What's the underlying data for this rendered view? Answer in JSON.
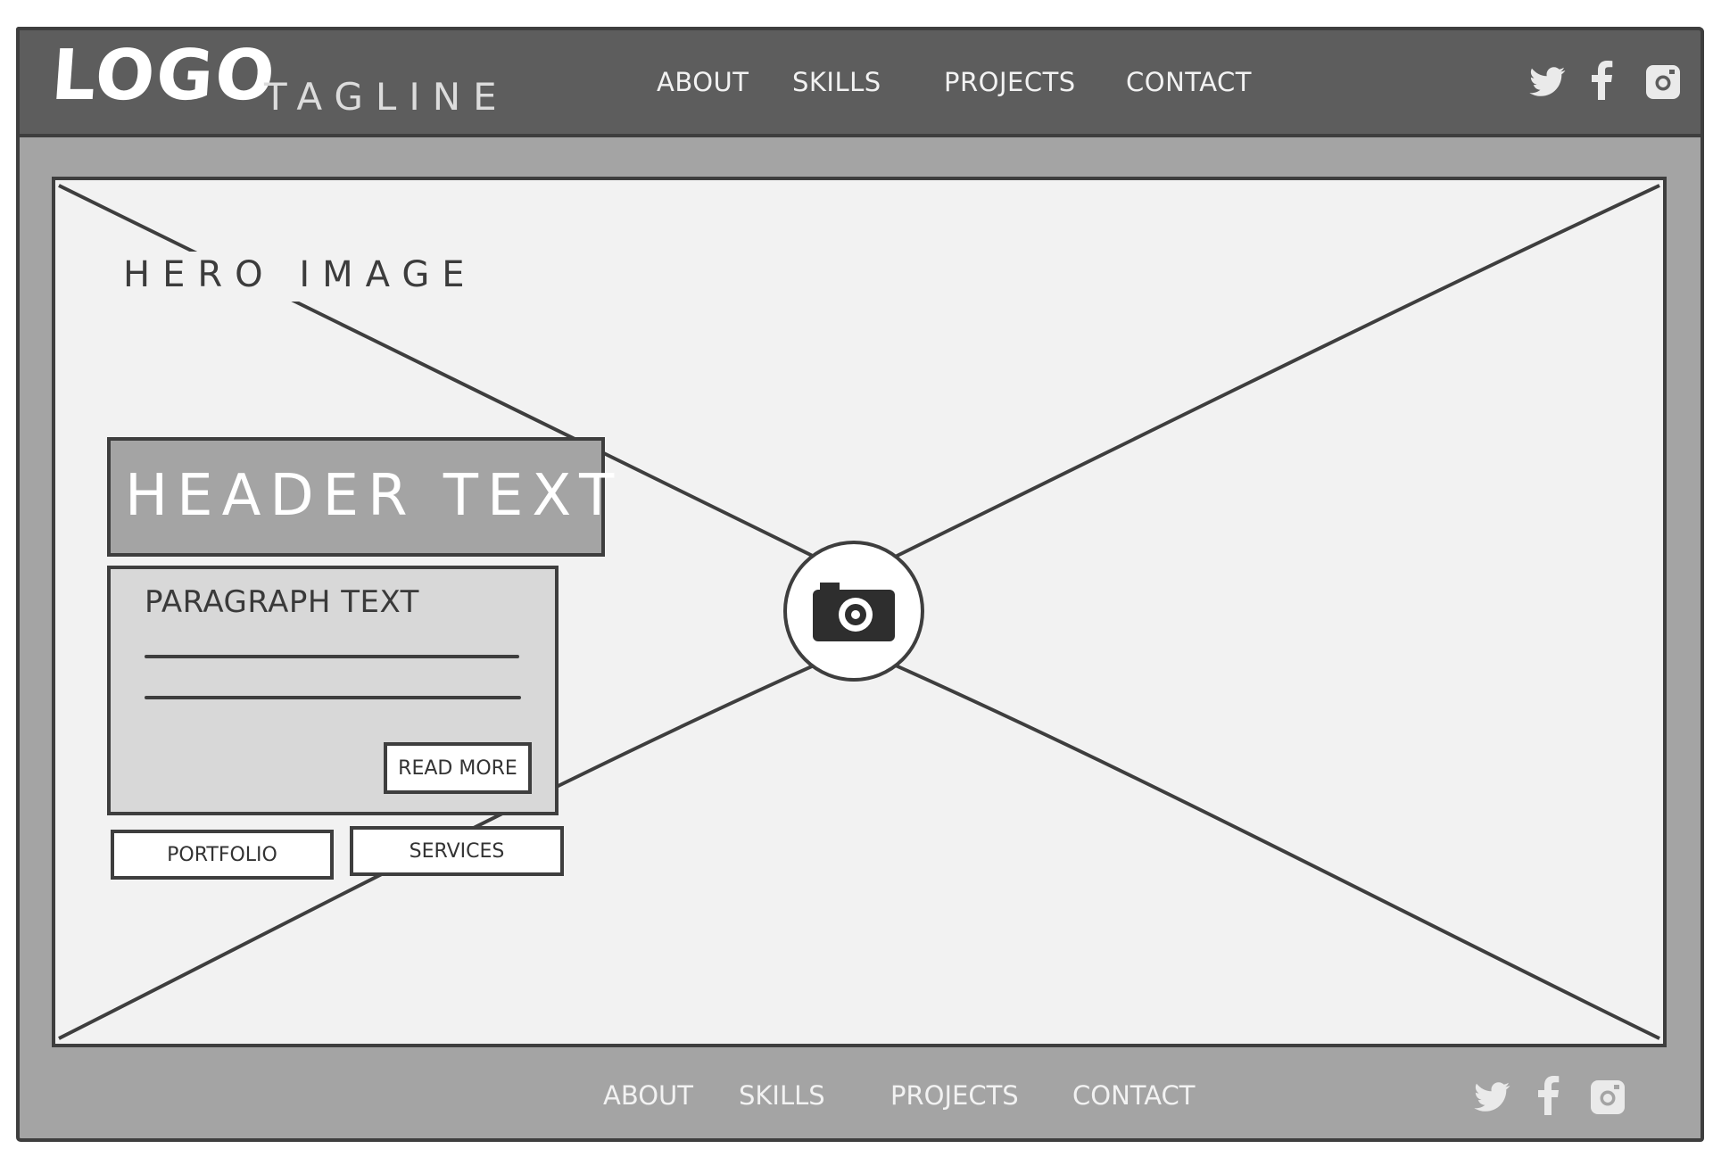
{
  "header": {
    "logo": "LOGO",
    "tagline": "TAGLINE",
    "nav": [
      "ABOUT",
      "SKILLS",
      "PROJECTS",
      "CONTACT"
    ]
  },
  "hero": {
    "label": "HERO IMAGE",
    "header_text": "HEADER TEXT",
    "paragraph_text": "PARAGRAPH TEXT",
    "read_more": "READ MORE",
    "buttons": [
      "PORTFOLIO",
      "SERVICES"
    ]
  },
  "footer": {
    "nav": [
      "ABOUT",
      "SKILLS",
      "PROJECTS",
      "CONTACT"
    ]
  },
  "social_icons": [
    "twitter-icon",
    "facebook-icon",
    "instagram-icon"
  ],
  "colors": {
    "topbar": "#5d5d5d",
    "frame": "#a4a4a4",
    "hero_bg": "#f2f2f2",
    "stroke": "#3e3e3e",
    "paragraph_box": "#d8d8d8"
  }
}
